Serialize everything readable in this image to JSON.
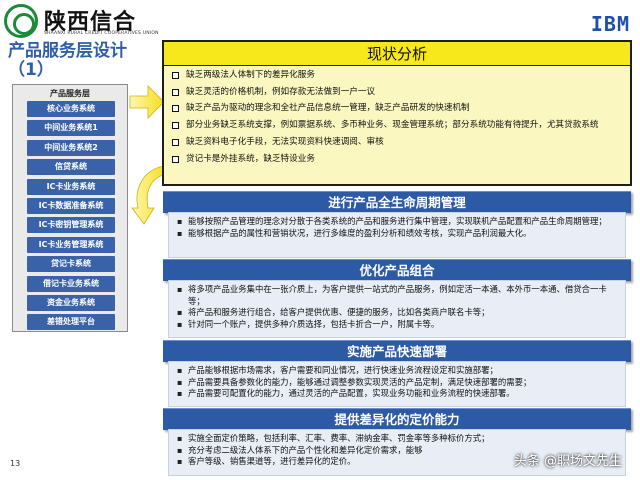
{
  "header": {
    "logo_cn": "陕西信合",
    "logo_en": "SHAANXI RURAL CREDIT COOPERATIVES UNION",
    "ibm": "IBM",
    "page_title": "产品服务层设计（1）"
  },
  "left_panel": {
    "header": "产品服务层",
    "items": [
      "核心业务系统",
      "中间业务系统1",
      "中间业务系统2",
      "信贷系统",
      "IC卡业务系统",
      "IC卡数据准备系统",
      "IC卡密钥管理系统",
      "IC卡业务管理系统",
      "贷记卡系统",
      "借记卡业务系统",
      "资金业务系统",
      "差错处理平台"
    ]
  },
  "analysis": {
    "title": "现状分析",
    "items": [
      "缺乏两级法人体制下的差异化服务",
      "缺乏灵活的价格机制，例如存款无法做到一户一议",
      "缺乏产品为驱动的理念和全社产品信息统一管理，缺乏产品研发的快速机制",
      "部分业务缺乏系统支撑，例如票据系统、多币种业务、现金管理系统；部分系统功能有待提升，尤其贷款系统",
      "缺乏资料电子化手段，无法实现资料快速调阅、审核",
      "贷记卡是外挂系统，缺乏特设业务"
    ]
  },
  "sections": [
    {
      "title": "进行产品全生命周期管理",
      "items": [
        "能够按照产品管理的理念对分散于各类系统的产品和服务进行集中管理，实现联机产品配置和产品生命周期管理；",
        "能够根据产品的属性和营销状况，进行多维度的盈利分析和绩效考核，实现产品利润最大化。"
      ]
    },
    {
      "title": "优化产品组合",
      "items": [
        "将多项产品业务集中在一张介质上，为客户提供一站式的产品服务，例如定活一本通、本外币一本通、借贷合一卡等；",
        "将产品和服务进行组合，给客户提供优惠、便捷的服务，比如各类商户联名卡等；",
        "针对同一个账户，提供多种介质选择，包括卡折合一户，附属卡等。"
      ]
    },
    {
      "title": "实施产品快速部署",
      "items": [
        "产品能够根据市场需求，客户需要和同业情况，进行快速业务流程设定和实施部署；",
        "产品需要具备参数化的能力，能够通过调整参数实现灵活的产品定制，满足快速部署的需要；",
        "产品需要可配置化的能力，通过灵活的产品配置，实现业务功能和业务流程的快速部署。"
      ]
    },
    {
      "title": "提供差异化的定价能力",
      "items": [
        "实施全面定价策略，包括利率、汇率、费率、滞纳金率、罚金率等多种标价方式；",
        "充分考虑二级法人体系下的产品个性化和差异化定价需求，能够",
        "客户等级、销售渠道等，进行差异化的定价。"
      ]
    }
  ],
  "footer": {
    "page_number": "13",
    "watermark": "头条 @职场文先生"
  },
  "colors": {
    "accent_blue": "#2d5aa5",
    "title_blue": "#2f5fa8",
    "analysis_title_yellow": "#f6e81a",
    "analysis_bg": "#fbf7c0",
    "section_body_bg": "#e8edf6",
    "logo_green": "#1b8a3a"
  }
}
